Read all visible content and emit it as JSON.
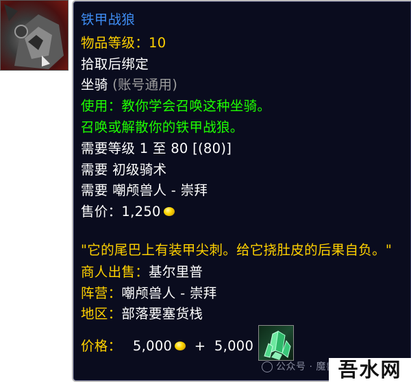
{
  "item": {
    "name": "铁甲战狼",
    "item_level_label": "物品等级：",
    "item_level_value": "10",
    "bind": "拾取后绑定",
    "type_label": "坐骑",
    "type_note": "(账号通用)",
    "use_line1": "使用：教你学会召唤这种坐骑。",
    "use_line2": "召唤或解散你的铁甲战狼。",
    "req_level": "需要等级 1 至 80 [(80)]",
    "req_skill": "需要 初级骑术",
    "req_rep": "需要 嘲颅兽人 - 崇拜",
    "sell_label": "售价：",
    "sell_value": "1,250",
    "flavor": "\"它的尾巴上有装甲尖刺。给它挠肚皮的后果自负。\"",
    "vendor_label": "商人出售：",
    "vendor_name": "基尔里普",
    "faction_label": "阵营：",
    "faction_name": "嘲颅兽人 - 崇拜",
    "zone_label": "地区：",
    "zone_name": "部落要塞货栈",
    "price_label": "价格：",
    "price_gold": "5,000",
    "price_plus": "+",
    "price_currency": "5,000"
  },
  "icons": {
    "item_icon": "armored-wolf-icon",
    "reward_icon": "green-crystal-icon",
    "coin": "gold-coin-icon"
  },
  "colors": {
    "background": "#0a0c1e",
    "name": "#3e8cf2",
    "item_level": "#ffd100",
    "green_text": "#1eff00",
    "flavor": "#ffd100"
  },
  "watermark": {
    "text": "公众号 · 魔兽世界研究所",
    "site": "吾水网"
  }
}
